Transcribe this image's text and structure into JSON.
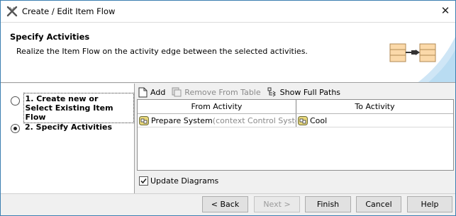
{
  "window": {
    "title": "Create / Edit Item Flow",
    "close_label": "✕"
  },
  "header": {
    "title": "Specify Activities",
    "description": "Realize the Item Flow on the activity edge between the selected activities."
  },
  "steps": [
    {
      "label": "1. Create new or\nSelect Existing Item Flow",
      "selected": false
    },
    {
      "label": "2. Specify Activities",
      "selected": true
    }
  ],
  "toolbar": {
    "add_label": "Add",
    "remove_label": "Remove From Table",
    "show_paths_label": "Show Full Paths"
  },
  "table": {
    "columns": [
      "From Activity",
      "To Activity"
    ],
    "rows": [
      {
        "from_name": "Prepare System",
        "from_context": "(context Control System)",
        "to_name": "Cool"
      }
    ]
  },
  "update_diagrams": {
    "label": "Update Diagrams",
    "checked": true
  },
  "buttons": {
    "back": "< Back",
    "next": "Next >",
    "finish": "Finish",
    "cancel": "Cancel",
    "help": "Help"
  },
  "colors": {
    "window_border": "#3c7fb1",
    "activity_icon": "#e8d77a",
    "header_graphic": "#fbd9a9"
  },
  "icons": {
    "app": "x-logo-icon",
    "add": "new-document-icon",
    "remove": "remove-icon",
    "show_paths": "tree-paths-icon",
    "activity": "activity-icon",
    "header": "item-flow-diagram-icon"
  }
}
